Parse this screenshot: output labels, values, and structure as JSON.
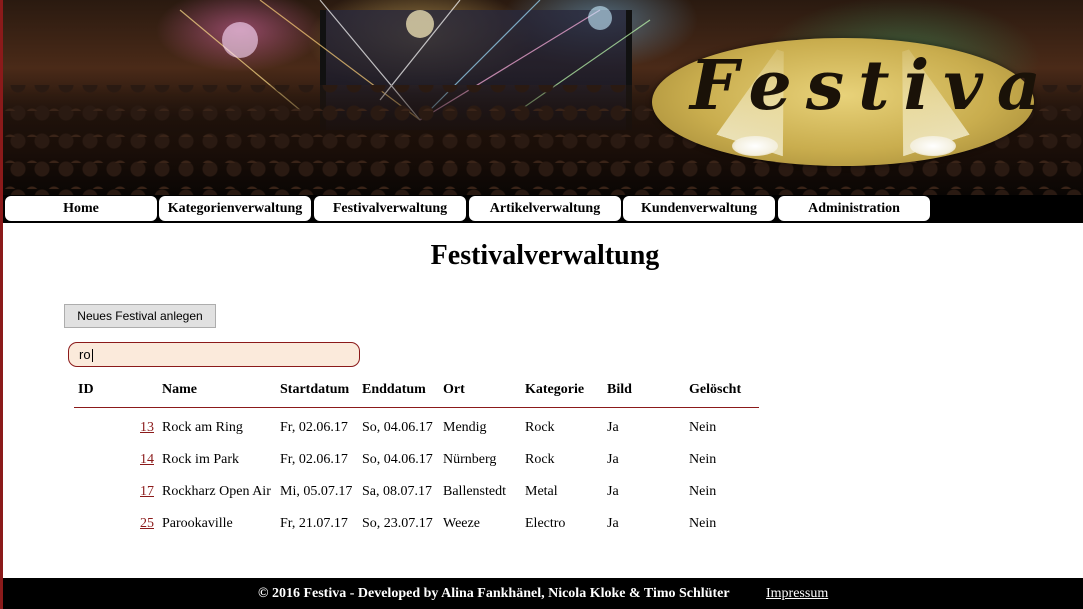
{
  "header": {
    "logo_text": "Festiva"
  },
  "nav": {
    "items": [
      {
        "label": "Home"
      },
      {
        "label": "Kategorienverwaltung"
      },
      {
        "label": "Festivalverwaltung"
      },
      {
        "label": "Artikelverwaltung"
      },
      {
        "label": "Kundenverwaltung"
      },
      {
        "label": "Administration"
      }
    ]
  },
  "main": {
    "title": "Festivalverwaltung",
    "new_button_label": "Neues Festival anlegen",
    "search_value": "ro"
  },
  "table": {
    "headers": [
      "ID",
      "Name",
      "Startdatum",
      "Enddatum",
      "Ort",
      "Kategorie",
      "Bild",
      "Gelöscht"
    ],
    "rows": [
      {
        "id": "13",
        "name": "Rock am Ring",
        "start": "Fr, 02.06.17",
        "end": "So, 04.06.17",
        "ort": "Mendig",
        "kategorie": "Rock",
        "bild": "Ja",
        "geloescht": "Nein"
      },
      {
        "id": "14",
        "name": "Rock im Park",
        "start": "Fr, 02.06.17",
        "end": "So, 04.06.17",
        "ort": "Nürnberg",
        "kategorie": "Rock",
        "bild": "Ja",
        "geloescht": "Nein"
      },
      {
        "id": "17",
        "name": "Rockharz Open Air",
        "start": "Mi, 05.07.17",
        "end": "Sa, 08.07.17",
        "ort": "Ballenstedt",
        "kategorie": "Metal",
        "bild": "Ja",
        "geloescht": "Nein"
      },
      {
        "id": "25",
        "name": "Parookaville",
        "start": "Fr, 21.07.17",
        "end": "So, 23.07.17",
        "ort": "Weeze",
        "kategorie": "Electro",
        "bild": "Ja",
        "geloescht": "Nein"
      }
    ]
  },
  "footer": {
    "copyright": "© 2016 Festiva - Developed by Alina Fankhänel, Nicola Kloke & Timo Schlüter",
    "impressum": "Impressum"
  },
  "colors": {
    "accent": "#8b1a1a",
    "nav_background": "#000000",
    "search_background": "#fbeadb"
  }
}
